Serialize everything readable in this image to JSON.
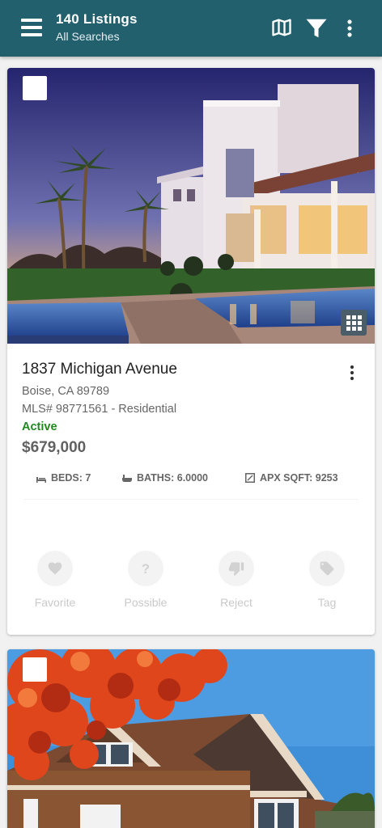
{
  "appbar": {
    "title": "140 Listings",
    "subtitle": "All Searches",
    "color": "#22606e",
    "icons": [
      "hamburger-menu-icon",
      "map-icon",
      "filter-icon",
      "more-vert-icon"
    ]
  },
  "listings": [
    {
      "address": "1837 Michigan Avenue",
      "city": "Boise, CA 89789",
      "mls": "MLS# 98771561 - Residential",
      "status": "Active",
      "status_color": "#1e8a1e",
      "price": "$679,000",
      "beds": "BEDS: 7",
      "baths": "BATHS: 6.0000",
      "sqft": "APX SQFT: 9253",
      "actions": {
        "favorite": "Favorite",
        "possible": "Possible",
        "reject": "Reject",
        "tag": "Tag"
      }
    }
  ]
}
